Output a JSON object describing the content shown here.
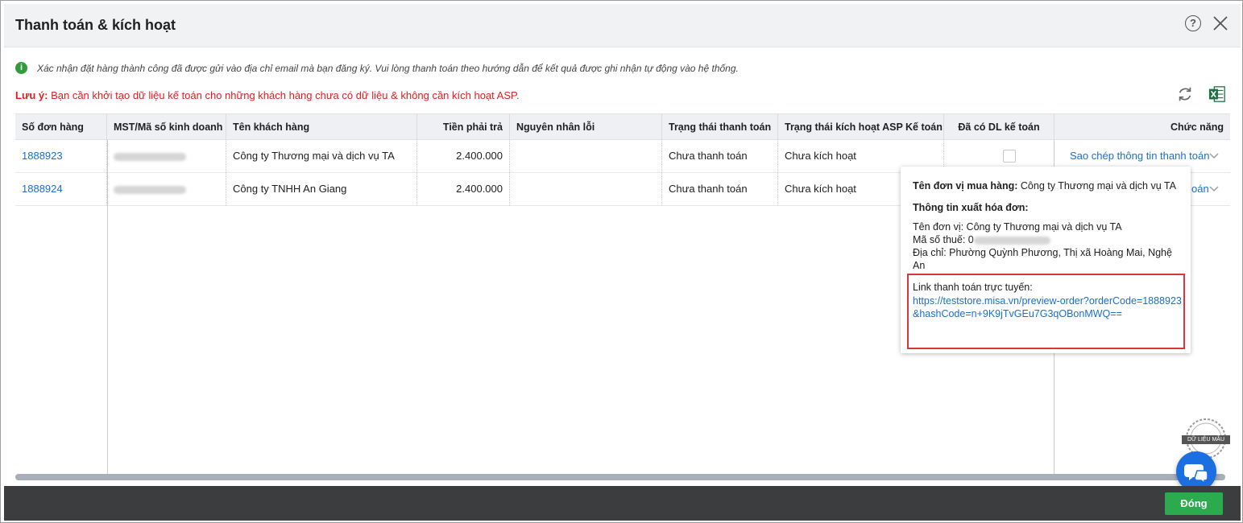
{
  "dialog": {
    "title": "Thanh toán & kích hoạt",
    "help_symbol": "?"
  },
  "info": {
    "icon_symbol": "i",
    "text": "Xác nhận đặt hàng thành công đã được gửi vào địa chỉ email mà bạn đăng ký. Vui lòng thanh toán theo hướng dẫn để kết quả được ghi nhận tự động vào hệ thống."
  },
  "note": {
    "label": "Lưu ý:",
    "text": " Bạn cần khởi tạo dữ liệu kế toán cho những khách hàng chưa có dữ liệu & không cần kích hoạt ASP."
  },
  "toolbar": {
    "refresh_icon": "refresh-icon",
    "excel_icon": "excel-export-icon"
  },
  "table": {
    "columns": [
      "Số đơn hàng",
      "MST/Mã số kinh doanh",
      "Tên khách hàng",
      "Tiền phải trả",
      "Nguyên nhân lỗi",
      "Trạng thái thanh toán",
      "Trạng thái kích hoạt ASP Kế toán",
      "Đã có DL kế toán",
      "Chức năng"
    ],
    "rows": [
      {
        "order_no": "1888923",
        "customer": "Công ty Thương mại và dịch vụ TA",
        "amount": "2.400.000",
        "error": "",
        "payment_status": "Chưa thanh toán",
        "activation_status": "Chưa kích hoạt",
        "action": "Sao chép thông tin thanh toán"
      },
      {
        "order_no": "1888924",
        "customer": "Công ty TNHH An Giang",
        "amount": "2.400.000",
        "error": "",
        "payment_status": "Chưa thanh toán",
        "activation_status": "Chưa kích hoạt",
        "action_partial": "oán"
      }
    ]
  },
  "popover": {
    "buyer_label": "Tên đơn vị mua hàng:",
    "buyer_value": " Công ty Thương mại và dịch vụ TA",
    "invoice_heading": "Thông tin xuất hóa đơn:",
    "unit_line": "Tên đơn vị: Công ty Thương mại và dịch vụ TA",
    "tax_label": "Mã số thuế: ",
    "tax_prefix": "0",
    "address_line": "Địa chỉ: Phường Quỳnh Phương, Thị xã Hoàng Mai, Nghệ An",
    "link_label": "Link thanh toán trực tuyến:",
    "link_url": "https://teststore.misa.vn/preview-order?orderCode=1888923&hashCode=n+9K9jTvGEu7G3qOBonMWQ=="
  },
  "watermark": {
    "text": "DỮ LIỆU MẪU"
  },
  "footer": {
    "close_label": "Đóng"
  }
}
